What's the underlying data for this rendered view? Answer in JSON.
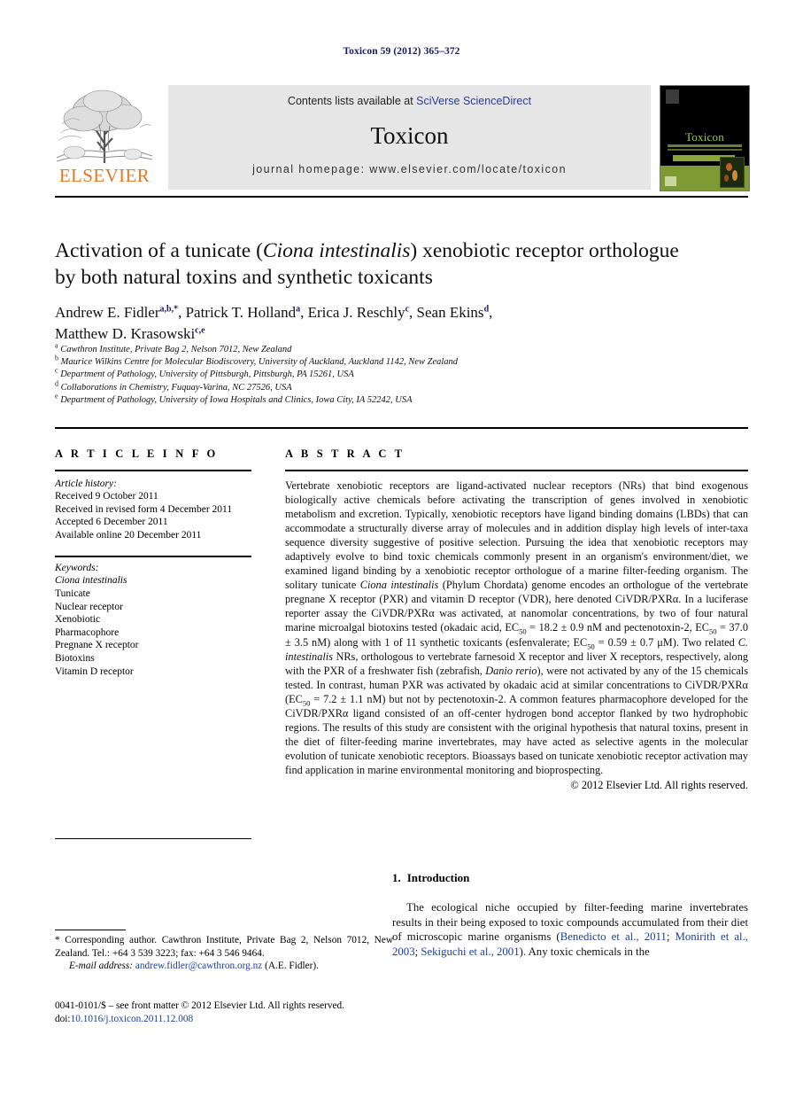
{
  "running_head": "Toxicon 59 (2012) 365–372",
  "masthead": {
    "publisher_name": "ELSEVIER",
    "contents_prefix": "Contents lists available at ",
    "sciencedirect_link": "SciVerse ScienceDirect",
    "journal_title": "Toxicon",
    "homepage": "journal homepage: www.elsevier.com/locate/toxicon",
    "cover_title": "Toxicon"
  },
  "article": {
    "title_line1": "Activation of a tunicate (",
    "title_italic": "Ciona intestinalis",
    "title_line1_end": ") xenobiotic receptor orthologue",
    "title_line2": "by both natural toxins and synthetic toxicants",
    "authors": [
      {
        "name": "Andrew E. Fidler",
        "marks": "a,b,*",
        "sep": ", "
      },
      {
        "name": "Patrick T. Holland",
        "marks": "a",
        "sep": ", "
      },
      {
        "name": "Erica J. Reschly",
        "marks": "c",
        "sep": ", "
      },
      {
        "name": "Sean Ekins",
        "marks": "d",
        "sep": ","
      },
      {
        "name": "Matthew D. Krasowski",
        "marks": "c,e",
        "sep": ""
      }
    ],
    "affiliations": [
      {
        "mark": "a",
        "text": "Cawthron Institute, Private Bag 2, Nelson 7012, New Zealand"
      },
      {
        "mark": "b",
        "text": "Maurice Wilkins Centre for Molecular Biodiscovery, University of Auckland, Auckland 1142, New Zealand"
      },
      {
        "mark": "c",
        "text": "Department of Pathology, University of Pittsburgh, Pittsburgh, PA 15261, USA"
      },
      {
        "mark": "d",
        "text": "Collaborations in Chemistry, Fuquay-Varina, NC 27526, USA"
      },
      {
        "mark": "e",
        "text": "Department of Pathology, University of Iowa Hospitals and Clinics, Iowa City, IA 52242, USA"
      }
    ]
  },
  "article_info": {
    "heading": "A R T I C L E   I N F O",
    "history_label": "Article history:",
    "history": [
      "Received 9 October 2011",
      "Received in revised form 4 December 2011",
      "Accepted 6 December 2011",
      "Available online 20 December 2011"
    ],
    "keywords_label": "Keywords:",
    "keywords": [
      {
        "text": "Ciona intestinalis",
        "italic": true
      },
      {
        "text": "Tunicate",
        "italic": false
      },
      {
        "text": "Nuclear receptor",
        "italic": false
      },
      {
        "text": "Xenobiotic",
        "italic": false
      },
      {
        "text": "Pharmacophore",
        "italic": false
      },
      {
        "text": "Pregnane X receptor",
        "italic": false
      },
      {
        "text": "Biotoxins",
        "italic": false
      },
      {
        "text": "Vitamin D receptor",
        "italic": false
      }
    ]
  },
  "abstract": {
    "heading": "A B S T R A C T",
    "paragraph": "Vertebrate xenobiotic receptors are ligand-activated nuclear receptors (NRs) that bind exogenous biologically active chemicals before activating the transcription of genes involved in xenobiotic metabolism and excretion. Typically, xenobiotic receptors have ligand binding domains (LBDs) that can accommodate a structurally diverse array of molecules and in addition display high levels of inter-taxa sequence diversity suggestive of positive selection. Pursuing the idea that xenobiotic receptors may adaptively evolve to bind toxic chemicals commonly present in an organism's environment/diet, we examined ligand binding by a xenobiotic receptor orthologue of a marine filter-feeding organism. The solitary tunicate Ciona intestinalis (Phylum Chordata) genome encodes an orthologue of the vertebrate pregnane X receptor (PXR) and vitamin D receptor (VDR), here denoted CiVDR/PXRα. In a luciferase reporter assay the CiVDR/PXRα was activated, at nanomolar concentrations, by two of four natural marine microalgal biotoxins tested (okadaic acid, EC50 = 18.2 ± 0.9 nM and pectenotoxin-2, EC50 = 37.0 ± 3.5 nM) along with 1 of 11 synthetic toxicants (esfenvalerate; EC50 = 0.59 ± 0.7 μM). Two related C. intestinalis NRs, orthologous to vertebrate farnesoid X receptor and liver X receptors, respectively, along with the PXR of a freshwater fish (zebrafish, Danio rerio), were not activated by any of the 15 chemicals tested. In contrast, human PXR was activated by okadaic acid at similar concentrations to CiVDR/PXRα (EC50 = 7.2 ± 1.1 nM) but not by pectenotoxin-2. A common features pharmacophore developed for the CiVDR/PXRα ligand consisted of an off-center hydrogen bond acceptor flanked by two hydrophobic regions. The results of this study are consistent with the original hypothesis that natural toxins, present in the diet of filter-feeding marine invertebrates, may have acted as selective agents in the molecular evolution of tunicate xenobiotic receptors. Bioassays based on tunicate xenobiotic receptor activation may find application in marine environmental monitoring and bioprospecting.",
    "copyright": "© 2012 Elsevier Ltd. All rights reserved."
  },
  "introduction": {
    "number": "1.",
    "heading": "Introduction",
    "paragraph_start": "The ecological niche occupied by filter-feeding marine invertebrates results in their being exposed to toxic compounds accumulated from their diet of microscopic marine organisms (",
    "citation1": "Benedicto et al., 2011",
    "citation_sep1": "; ",
    "citation2": "Monirith et al., 2003",
    "citation_sep2": "; ",
    "citation3": "Sekiguchi et al., 2001",
    "paragraph_end": "). Any toxic chemicals in the"
  },
  "footnotes": {
    "corresponding": "* Corresponding author. Cawthron Institute, Private Bag 2, Nelson 7012, New Zealand. Tel.: +64 3 539 3223; fax: +64 3 546 9464.",
    "email_label": "E-mail address:",
    "email": "andrew.fidler@cawthron.org.nz",
    "email_suffix": "(A.E. Fidler).",
    "issn_line": "0041-0101/$ – see front matter © 2012 Elsevier Ltd. All rights reserved.",
    "doi_label": "doi:",
    "doi": "10.1016/j.toxicon.2011.12.008"
  },
  "colors": {
    "elsevier_orange": "#e87722",
    "link_blue": "#1a3fa0",
    "running_head_blue": "#1a1a66",
    "banner_gray": "#e6e6e6",
    "cover_green": "#7d9a33"
  }
}
